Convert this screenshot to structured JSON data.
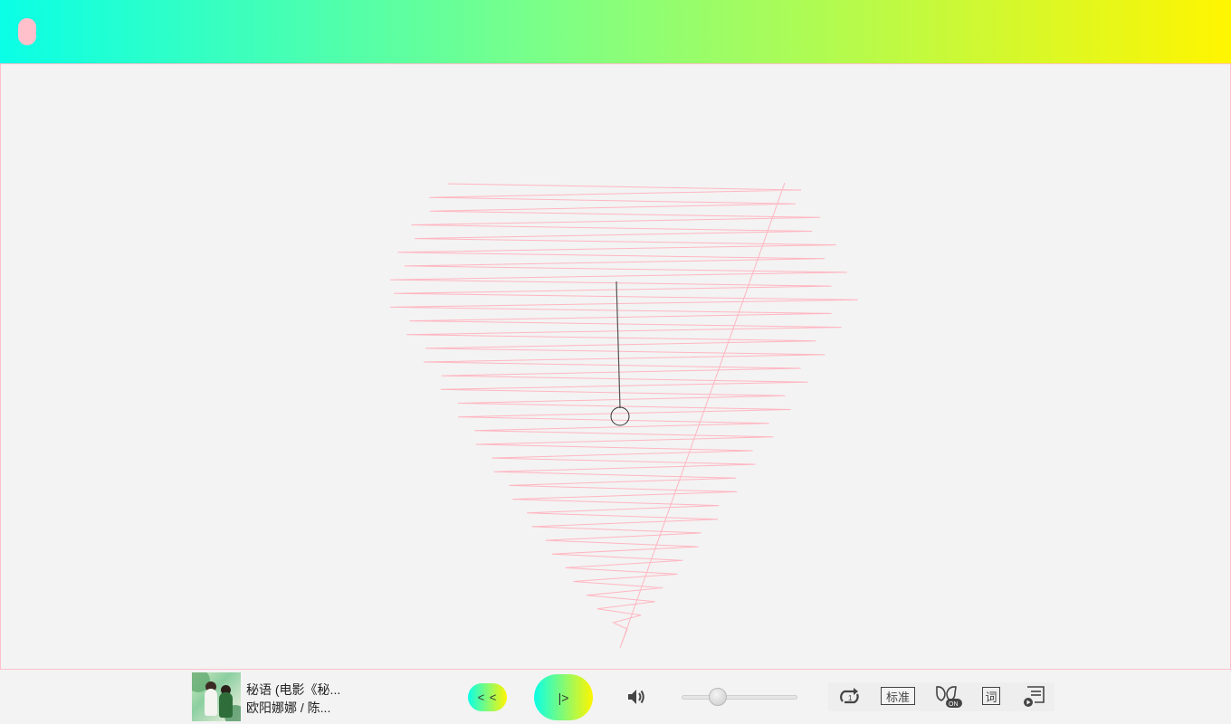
{
  "topbar": {
    "gradient_colors": [
      "#0affe6",
      "#7dff86",
      "#fff500"
    ],
    "menu_button_color": "#ffc0cb"
  },
  "visualizer": {
    "line_color": "#ffb6c1",
    "needle_color": "#555555"
  },
  "player": {
    "song_title": "秘语 (电影《秘...",
    "artist": "欧阳娜娜 / 陈...",
    "prev_label": "< <",
    "play_label": "|>",
    "volume_level": 0.3,
    "quality_label": "标准",
    "lyrics_label": "词",
    "icons": {
      "volume": "speaker-icon",
      "loop": "loop-one-icon",
      "effect": "sound-effect-on-icon",
      "playlist": "playlist-icon"
    }
  }
}
